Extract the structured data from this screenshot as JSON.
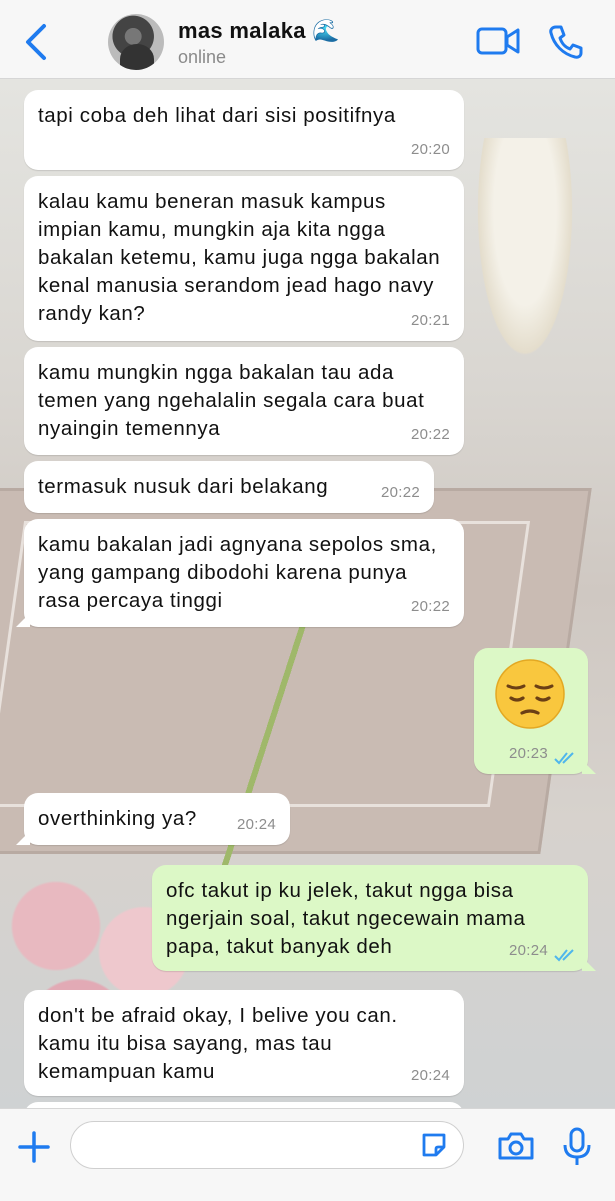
{
  "header": {
    "contact_name": "mas malaka 🌊",
    "status": "online"
  },
  "messages": [
    {
      "direction": "in",
      "text": "tapi coba deh lihat dari sisi positifnya",
      "time": "20:20"
    },
    {
      "direction": "in",
      "text": "kalau kamu beneran masuk kampus impian kamu, mungkin aja kita ngga bakalan ketemu, kamu juga ngga bakalan kenal manusia serandom jead hago navy randy kan?",
      "time": "20:21"
    },
    {
      "direction": "in",
      "text": "kamu mungkin ngga bakalan tau ada temen yang ngehalalin segala cara buat nyaingin temennya",
      "time": "20:22"
    },
    {
      "direction": "in",
      "text": "termasuk nusuk dari belakang",
      "time": "20:22"
    },
    {
      "direction": "in",
      "text": "kamu bakalan jadi agnyana sepolos sma, yang gampang dibodohi karena punya rasa percaya tinggi",
      "time": "20:22"
    },
    {
      "direction": "out",
      "emoji": "pensive-face",
      "time": "20:23",
      "read": true
    },
    {
      "direction": "in",
      "text": "overthinking ya?",
      "time": "20:24"
    },
    {
      "direction": "out",
      "text": "ofc takut ip ku jelek, takut ngga bisa ngerjain soal, takut ngecewain mama papa, takut banyak deh",
      "time": "20:24",
      "read": true
    },
    {
      "direction": "in",
      "text": "don't be afraid okay, I belive you can. kamu itu bisa sayang, mas tau kemampuan kamu",
      "time": "20:24"
    }
  ],
  "colors": {
    "accent": "#1f7bef",
    "incoming_bubble": "#ffffff",
    "outgoing_bubble": "#dcf8c6",
    "read_ticks": "#4fb6ec"
  },
  "icons": [
    "back-chevron-icon",
    "video-call-icon",
    "phone-icon",
    "plus-icon",
    "sticker-icon",
    "camera-icon",
    "microphone-icon"
  ]
}
